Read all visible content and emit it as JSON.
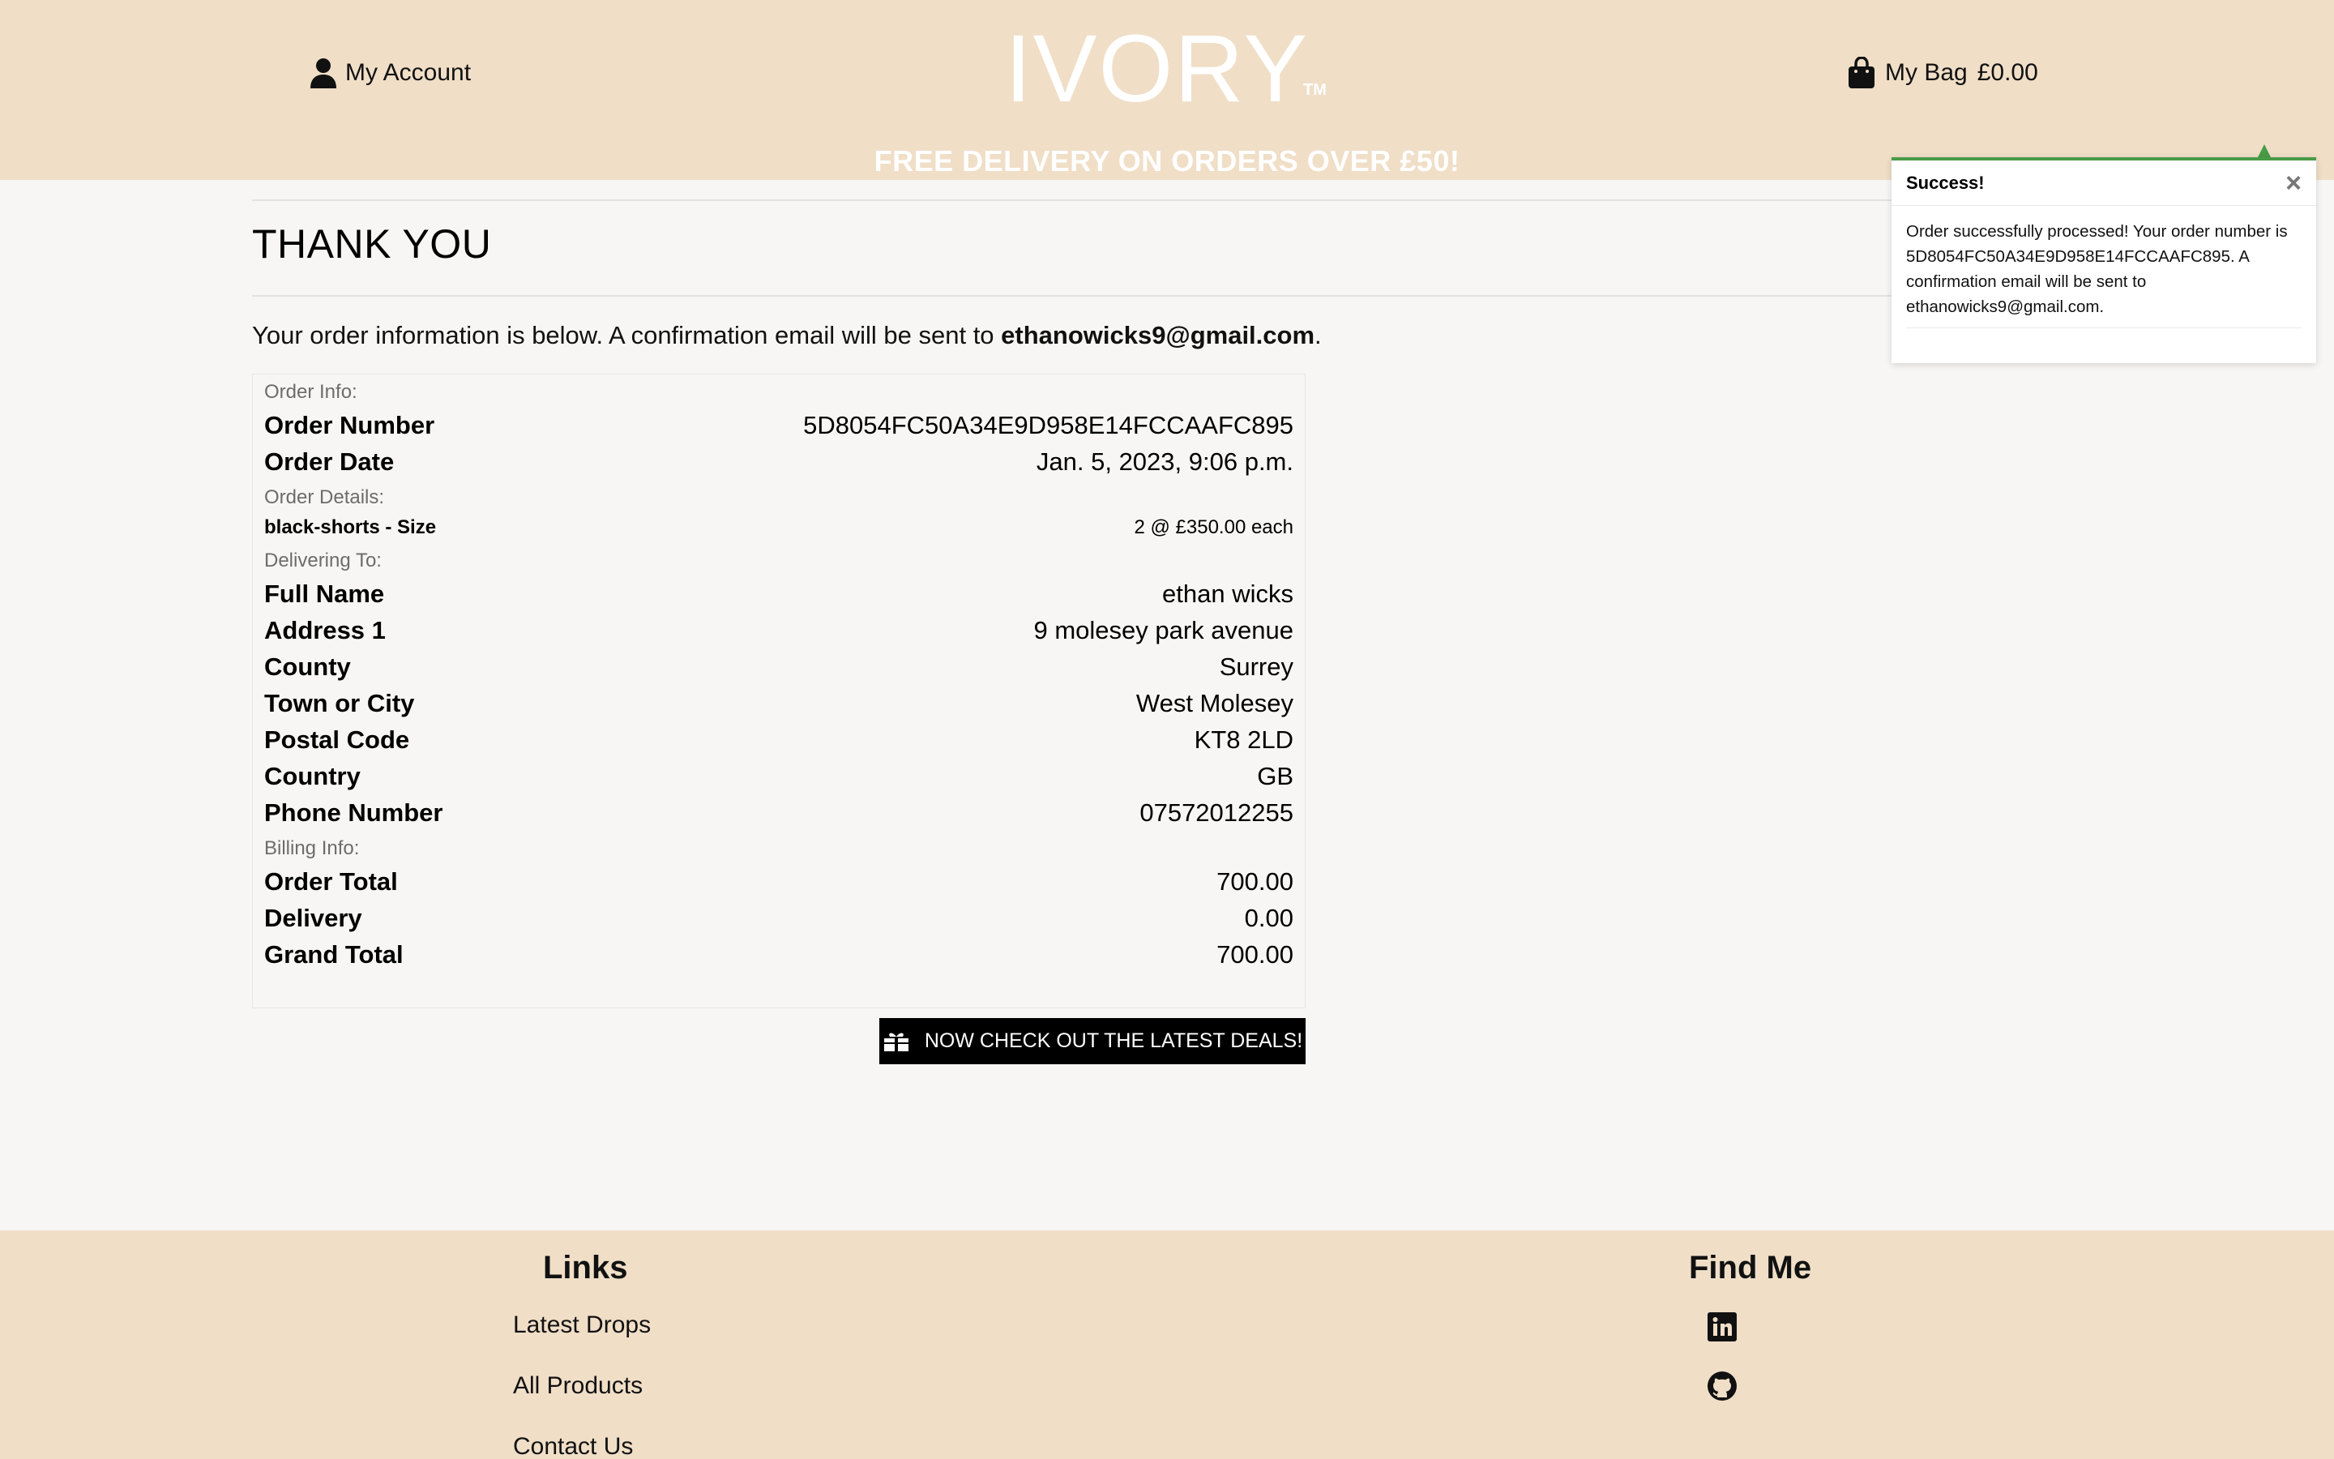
{
  "header": {
    "account_label": "My Account",
    "logo": "IVORY",
    "trademark": "TM",
    "bag_label": "My Bag",
    "bag_total": "£0.00",
    "banner": "FREE DELIVERY ON ORDERS OVER £50!"
  },
  "main": {
    "title": "THANK YOU",
    "intro_text": "Your order information is below. A confirmation email will be sent to ",
    "intro_email": "ethanowicks9@gmail.com",
    "intro_end": "."
  },
  "order": {
    "order_info_label": "Order Info:",
    "order_number_label": "Order Number",
    "order_number": "5D8054FC50A34E9D958E14FCCAAFC895",
    "order_date_label": "Order Date",
    "order_date": "Jan. 5, 2023, 9:06 p.m.",
    "order_details_label": "Order Details:",
    "item_name": "black-shorts - Size",
    "item_qty": "2 @ £350.00 each",
    "delivering_label": "Delivering To:",
    "full_name_label": "Full Name",
    "full_name": "ethan wicks",
    "address1_label": "Address 1",
    "address1": "9 molesey park avenue",
    "county_label": "County",
    "county": "Surrey",
    "town_label": "Town or City",
    "town": "West Molesey",
    "postcode_label": "Postal Code",
    "postcode": "KT8 2LD",
    "country_label": "Country",
    "country": "GB",
    "phone_label": "Phone Number",
    "phone": "07572012255",
    "billing_label": "Billing Info:",
    "order_total_label": "Order Total",
    "order_total": "700.00",
    "delivery_label": "Delivery",
    "delivery": "0.00",
    "grand_total_label": "Grand Total",
    "grand_total": "700.00"
  },
  "cta_label": "NOW CHECK OUT THE LATEST DEALS!",
  "toast": {
    "title": "Success!",
    "close": "×",
    "message": "Order successfully processed! Your order number is 5D8054FC50A34E9D958E14FCCAAFC895. A confirmation email will be sent to ethanowicks9@gmail.com."
  },
  "footer": {
    "links_heading": "Links",
    "links": [
      "Latest Drops",
      "All Products",
      "Contact Us"
    ],
    "find_heading": "Find Me",
    "icons": [
      "linkedin-icon",
      "github-icon"
    ]
  },
  "colors": {
    "header_bg": "#f0dec7",
    "page_bg": "#f7f6f4",
    "toast_accent": "#4a9b47",
    "button_bg": "#000000"
  }
}
